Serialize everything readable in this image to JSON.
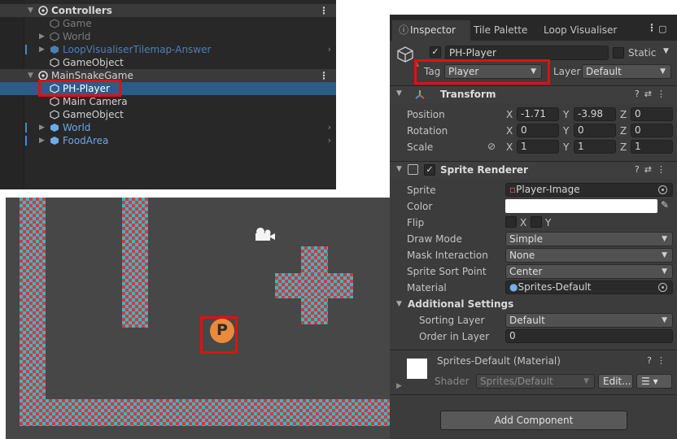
{
  "hierarchy": {
    "rows": [
      {
        "label": "Controllers"
      },
      {
        "label": "Game"
      },
      {
        "label": "World"
      },
      {
        "label": "LoopVisualiserTilemap-Answer"
      },
      {
        "label": "GameObject"
      },
      {
        "label": "MainSnakeGame"
      },
      {
        "label": "PH-Player"
      },
      {
        "label": "Main Camera"
      },
      {
        "label": "GameObject"
      },
      {
        "label": "World"
      },
      {
        "label": "FoodArea"
      }
    ]
  },
  "scene": {
    "player_glyph": "P",
    "camera_icon": "camera-icon"
  },
  "inspector": {
    "tabs": [
      "Inspector",
      "Tile Palette",
      "Loop Visualiser"
    ],
    "object_name": "PH-Player",
    "static_label": "Static",
    "tag_label": "Tag",
    "tag_value": "Player",
    "layer_label": "Layer",
    "layer_value": "Default",
    "transform": {
      "title": "Transform",
      "position_label": "Position",
      "rotation_label": "Rotation",
      "scale_label": "Scale",
      "position": {
        "x": "-1.71",
        "y": "-3.98",
        "z": "0"
      },
      "rotation": {
        "x": "0",
        "y": "0",
        "z": "0"
      },
      "scale": {
        "x": "1",
        "y": "1",
        "z": "1"
      }
    },
    "sprite_renderer": {
      "title": "Sprite Renderer",
      "sprite_label": "Sprite",
      "sprite_value": "Player-Image",
      "color_label": "Color",
      "color_value": "#ffffff",
      "flip_label": "Flip",
      "flip_x": "X",
      "flip_y": "Y",
      "draw_mode_label": "Draw Mode",
      "draw_mode_value": "Simple",
      "mask_label": "Mask Interaction",
      "mask_value": "None",
      "sort_point_label": "Sprite Sort Point",
      "sort_point_value": "Center",
      "material_label": "Material",
      "material_value": "Sprites-Default",
      "additional_title": "Additional Settings",
      "sorting_layer_label": "Sorting Layer",
      "sorting_layer_value": "Default",
      "order_label": "Order in Layer",
      "order_value": "0"
    },
    "material": {
      "title": "Sprites-Default (Material)",
      "shader_label": "Shader",
      "shader_value": "Sprites/Default",
      "edit_label": "Edit..."
    },
    "add_component_label": "Add Component"
  },
  "colors": {
    "highlight_red": "#e01010",
    "selection_blue": "#2c5d87",
    "wall_red": "#d23b3b",
    "wall_cyan": "#3bb5c8",
    "player_orange": "#ea8a3a"
  }
}
